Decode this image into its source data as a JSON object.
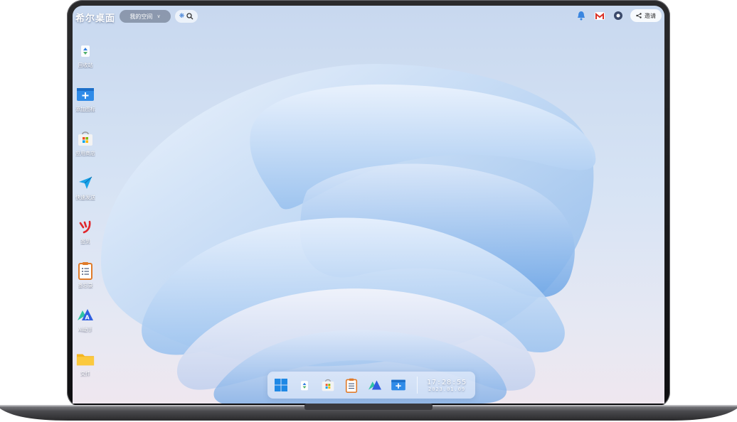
{
  "topbar": {
    "brand": "希尔桌面",
    "space_label": "我的空间",
    "share_label": "邀请"
  },
  "desktop_icons": [
    {
      "label": "回收站",
      "icon": "recycle-bin-icon"
    },
    {
      "label": "添加图标",
      "icon": "add-widget-icon"
    },
    {
      "label": "应用商店",
      "icon": "app-store-icon"
    },
    {
      "label": "快速发送",
      "icon": "paper-plane-icon"
    },
    {
      "label": "签到",
      "icon": "sign-in-icon"
    },
    {
      "label": "备忘录",
      "icon": "clipboard-icon"
    },
    {
      "label": "AI助手",
      "icon": "ai-assistant-icon"
    },
    {
      "label": "文件",
      "icon": "folder-icon"
    }
  ],
  "dock": {
    "time": "17:28:55",
    "date": "2023.01.09"
  },
  "colors": {
    "accent": "#2f7de1",
    "wallpaper_top": "#c8d8ef",
    "wallpaper_bottom": "#efe7ef"
  }
}
